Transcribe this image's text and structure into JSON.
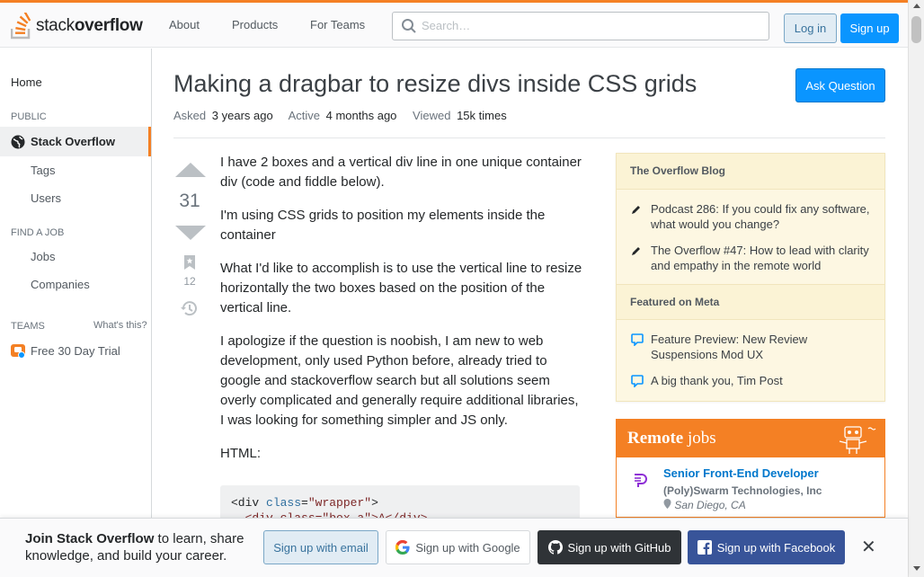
{
  "header": {
    "logo_text_light": "stack",
    "logo_text_bold": "overflow",
    "nav": [
      "About",
      "Products",
      "For Teams"
    ],
    "search_placeholder": "Search…",
    "login_label": "Log in",
    "signup_label": "Sign up",
    "accent_color": "#f48024"
  },
  "sidebar": {
    "home": "Home",
    "public_label": "PUBLIC",
    "active_item": "Stack Overflow",
    "items": [
      "Tags",
      "Users"
    ],
    "find_job_label": "FIND A JOB",
    "job_items": [
      "Jobs",
      "Companies"
    ],
    "teams_label": "TEAMS",
    "whats_this": "What's this?",
    "trial": "Free 30 Day Trial"
  },
  "question": {
    "title": "Making a dragbar to resize divs inside CSS grids",
    "ask_button": "Ask Question",
    "asked_label": "Asked",
    "asked_value": "3 years ago",
    "active_label": "Active",
    "active_value": "4 months ago",
    "viewed_label": "Viewed",
    "viewed_value": "15k times",
    "votes": "31",
    "bookmarks": "12",
    "paragraphs": [
      "I have 2 boxes and a vertical div line in one unique container div (code and fiddle below).",
      "I'm using CSS grids to position my elements inside the container",
      "What I'd like to accomplish is to use the vertical line to resize horizontally the two boxes based on the position of the vertical line.",
      "I apologize if the question is noobish, I am new to web development, only used Python before, already tried to google and stackoverflow search but all solutions seem overly complicated and generally require additional libraries, I was looking for something simpler and JS only.",
      "HTML:"
    ],
    "code_line1_tag_open": "<div ",
    "code_line1_attr": "class",
    "code_line1_eq": "=",
    "code_line1_val": "\"wrapper\"",
    "code_line1_close": ">",
    "code_line2": "  <div class=\"box a\">A</div>"
  },
  "blog": {
    "heading": "The Overflow Blog",
    "items": [
      "Podcast 286: If you could fix any software, what would you change?",
      "The Overflow #47: How to lead with clarity and empathy in the remote world"
    ],
    "meta_heading": "Featured on Meta",
    "meta_items": [
      "Feature Preview: New Review Suspensions Mod UX",
      "A big thank you, Tim Post"
    ]
  },
  "remote_jobs": {
    "heading_bold": "Remote",
    "heading_rest": " jobs",
    "job_title": "Senior Front-End Developer",
    "company": "(Poly)Swarm Technologies, Inc",
    "location": "San Diego, CA"
  },
  "footer": {
    "text_bold": "Join Stack Overflow",
    "text_rest": " to learn, share knowledge, and build your career.",
    "email": "Sign up with email",
    "google": "Sign up with Google",
    "github": "Sign up with GitHub",
    "facebook": "Sign up with Facebook",
    "close": "✕"
  }
}
